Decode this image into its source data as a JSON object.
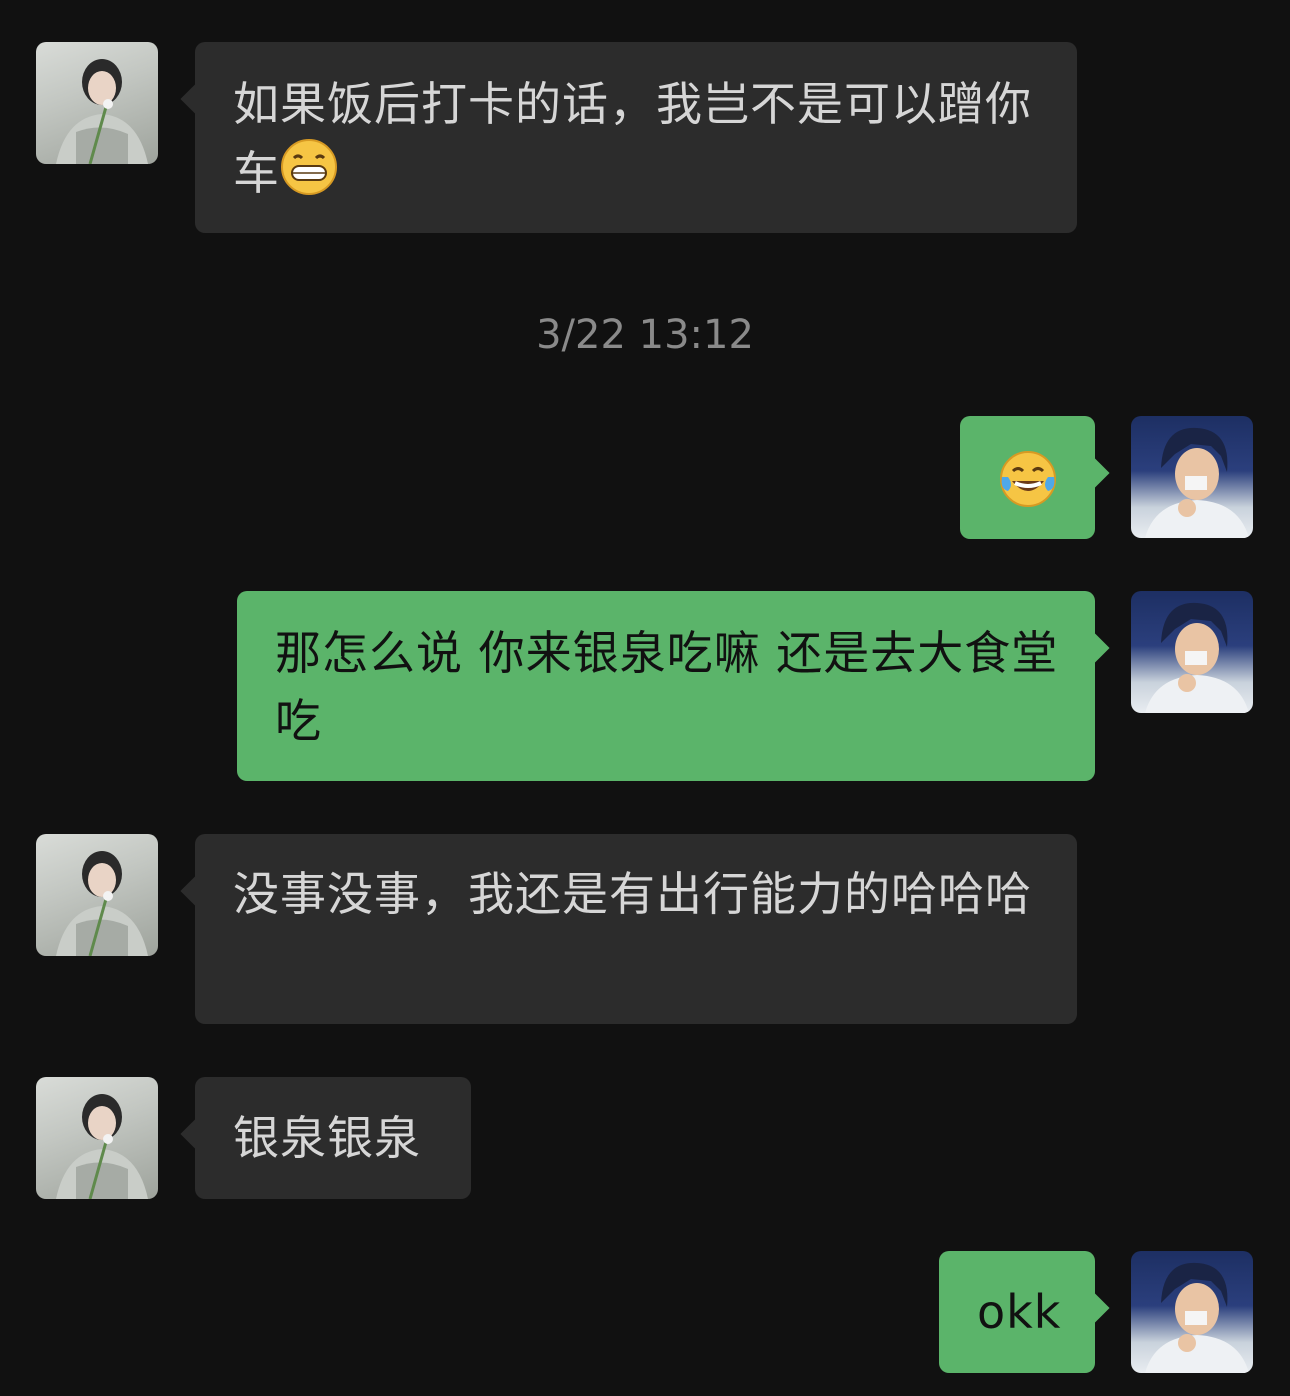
{
  "messages": [
    {
      "from": "contact",
      "text": "如果饭后打卡的话，我岂不是可以蹭你车",
      "emoji": "grinning-face-emoji"
    },
    {
      "from": "me",
      "text": "",
      "emoji": "tears-of-joy-emoji"
    },
    {
      "from": "me",
      "text": "那怎么说 你来银泉吃嘛 还是去大食堂吃"
    },
    {
      "from": "contact",
      "text": "没事没事，我还是有出行能力的哈哈哈"
    },
    {
      "from": "contact",
      "text": "银泉银泉"
    },
    {
      "from": "me",
      "text": "okk"
    }
  ],
  "timestamp": "3/22 13:12",
  "colors": {
    "background": "#111111",
    "incoming_bubble": "#2c2c2c",
    "outgoing_bubble": "#5bb46a",
    "incoming_text": "#d6d6d6",
    "outgoing_text": "#111111",
    "timestamp_text": "#8a8a8a"
  }
}
